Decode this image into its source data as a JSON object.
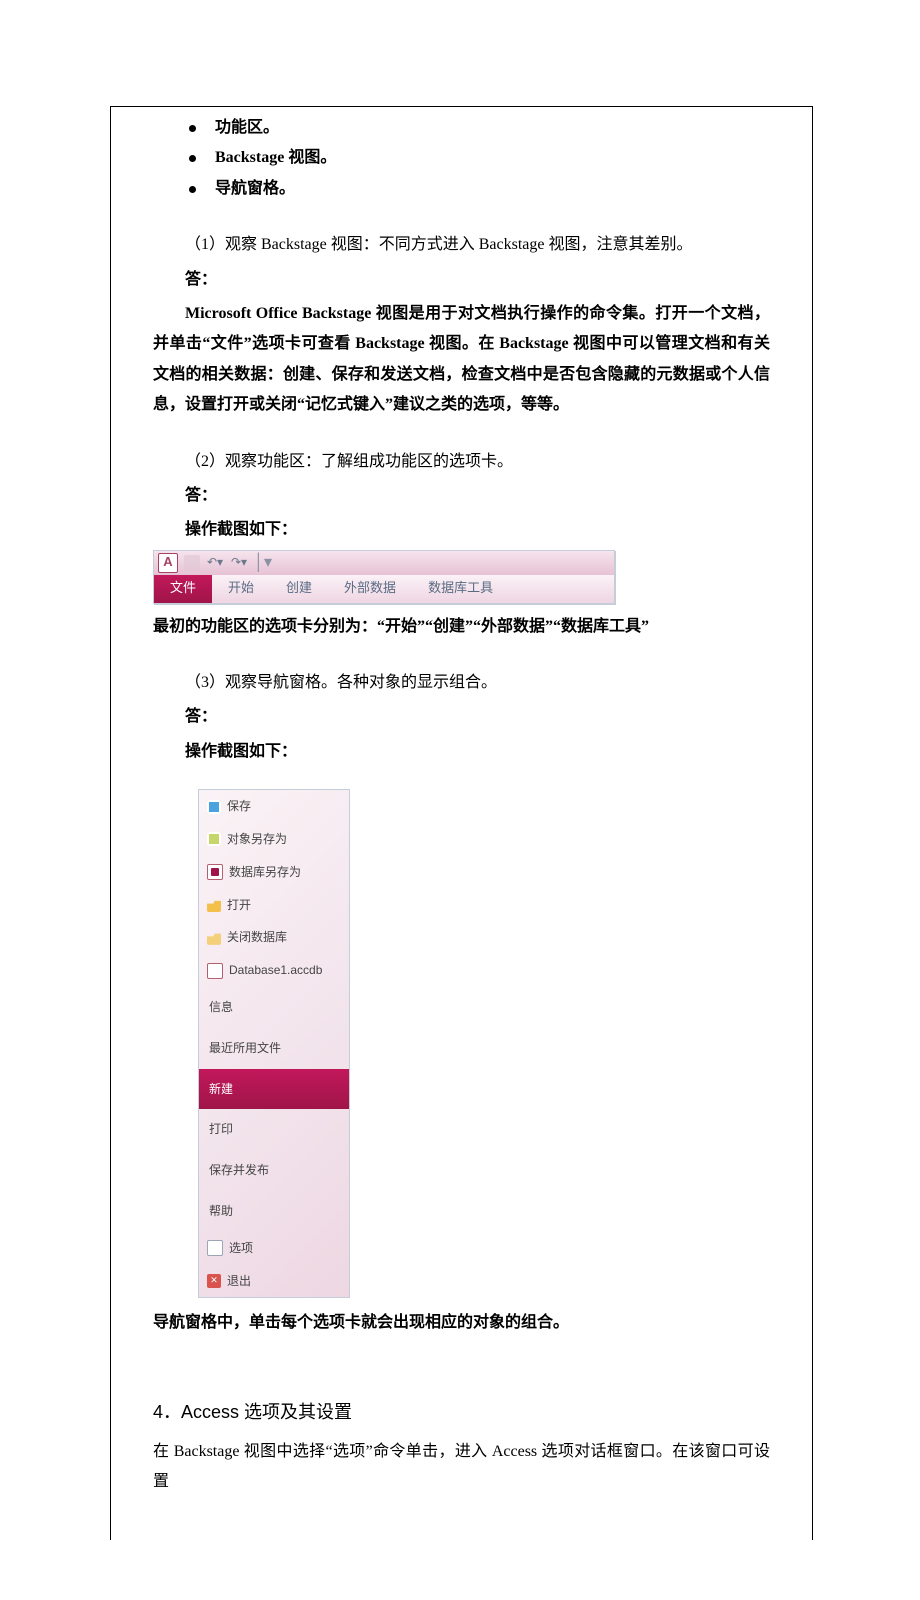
{
  "bullets": [
    "功能区。",
    "Backstage 视图。",
    "导航窗格。"
  ],
  "q1": {
    "prompt": "（1）观察 Backstage 视图：不同方式进入 Backstage 视图，注意其差别。",
    "ans_label": "答：",
    "explain": "Microsoft Office Backstage 视图是用于对文档执行操作的命令集。打开一个文档，并单击“文件”选项卡可查看 Backstage 视图。在 Backstage 视图中可以管理文档和有关文档的相关数据：创建、保存和发送文档，检查文档中是否包含隐藏的元数据或个人信息，设置打开或关闭“记忆式键入”建议之类的选项，等等。"
  },
  "q2": {
    "prompt": "（2）观察功能区：了解组成功能区的选项卡。",
    "ans_label": "答：",
    "shot_label": "操作截图如下：",
    "conclusion": "最初的功能区的选项卡分别为：“开始”“创建”“外部数据”“数据库工具”"
  },
  "ribbon": {
    "logo": "A",
    "tabs": [
      "文件",
      "开始",
      "创建",
      "外部数据",
      "数据库工具"
    ]
  },
  "q3": {
    "prompt": "（3）观察导航窗格。各种对象的显示组合。",
    "ans_label": "答：",
    "shot_label": "操作截图如下：",
    "conclusion": "导航窗格中，单击每个选项卡就会出现相应的对象的组合。"
  },
  "backstage_items": [
    {
      "icon": "ic-save",
      "label": "保存"
    },
    {
      "icon": "ic-saveas",
      "label": "对象另存为"
    },
    {
      "icon": "ic-dbsave",
      "label": "数据库另存为"
    },
    {
      "icon": "ic-open",
      "label": "打开"
    },
    {
      "icon": "ic-close",
      "label": "关闭数据库"
    },
    {
      "icon": "ic-db",
      "label": "Database1.accdb"
    },
    {
      "icon": "",
      "label": "信息",
      "tall": true
    },
    {
      "icon": "",
      "label": "最近所用文件",
      "tall": true
    },
    {
      "icon": "",
      "label": "新建",
      "tall": true,
      "selected": true
    },
    {
      "icon": "",
      "label": "打印",
      "tall": true
    },
    {
      "icon": "",
      "label": "保存并发布",
      "tall": true
    },
    {
      "icon": "",
      "label": "帮助",
      "tall": true
    },
    {
      "icon": "ic-opt",
      "label": "选项"
    },
    {
      "icon": "ic-exit",
      "label": "退出"
    }
  ],
  "section4": {
    "title": "4．Access 选项及其设置",
    "body": "在 Backstage 视图中选择“选项”命令单击，进入 Access 选项对话框窗口。在该窗口可设置"
  }
}
